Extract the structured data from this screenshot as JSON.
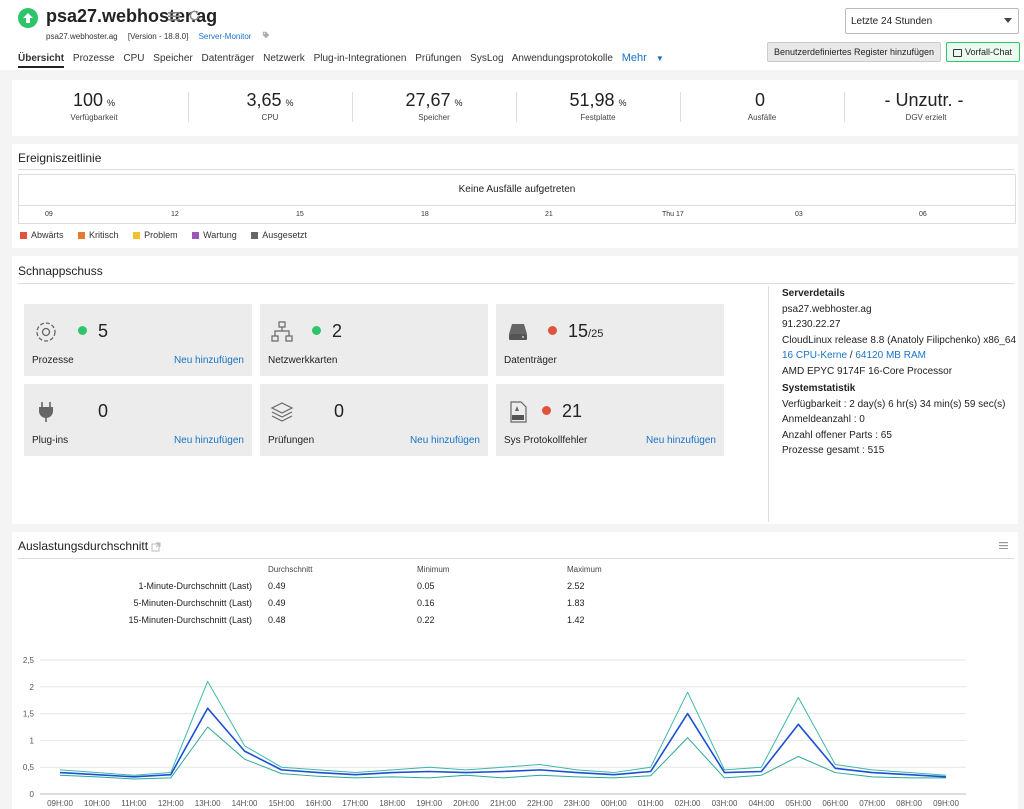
{
  "header": {
    "host": "psa27.webhoster.ag",
    "subhost": "psa27.webhoster.ag",
    "version": "[Version - 18.8.0]",
    "monitor_type": "Server-Monitor",
    "time_range": "Letzte 24 Stunden",
    "register_button": "Benutzerdefiniertes Register hinzufügen",
    "chat_button": "Vorfall-Chat"
  },
  "nav": {
    "tabs": [
      "Übersicht",
      "Prozesse",
      "CPU",
      "Speicher",
      "Datenträger",
      "Netzwerk",
      "Plug-in-Integrationen",
      "Prüfungen",
      "SysLog",
      "Anwendungsprotokolle"
    ],
    "more": "Mehr"
  },
  "kpis": [
    {
      "value": "100",
      "unit": "%",
      "label": "Verfügbarkeit"
    },
    {
      "value": "3,65",
      "unit": "%",
      "label": "CPU"
    },
    {
      "value": "27,67",
      "unit": "%",
      "label": "Speicher"
    },
    {
      "value": "51,98",
      "unit": "%",
      "label": "Festplatte"
    },
    {
      "value": "0",
      "unit": "",
      "label": "Ausfälle"
    },
    {
      "value": "- Unzutr. -",
      "unit": "",
      "label": "DGV erzielt"
    }
  ],
  "timeline": {
    "title": "Ereigniszeitlinie",
    "message": "Keine Ausfälle aufgetreten",
    "ticks": [
      "09",
      "12",
      "15",
      "18",
      "21",
      "Thu 17",
      "03",
      "06"
    ],
    "legend": [
      {
        "label": "Abwärts",
        "color": "#e0523a"
      },
      {
        "label": "Kritisch",
        "color": "#e87a30"
      },
      {
        "label": "Problem",
        "color": "#f2c12e"
      },
      {
        "label": "Wartung",
        "color": "#9b59b6"
      },
      {
        "label": "Ausgesetzt",
        "color": "#666666"
      }
    ]
  },
  "snapshot": {
    "title": "Schnappschuss",
    "add_label": "Neu hinzufügen",
    "cards": [
      {
        "name": "Prozesse",
        "value": "5",
        "sub": "",
        "status": "green"
      },
      {
        "name": "Netzwerkkarten",
        "value": "2",
        "sub": "",
        "status": "green"
      },
      {
        "name": "Datenträger",
        "value": "15",
        "sub": "/25",
        "status": "red"
      },
      {
        "name": "Plug-ins",
        "value": "0",
        "sub": "",
        "status": ""
      },
      {
        "name": "Prüfungen",
        "value": "0",
        "sub": "",
        "status": ""
      },
      {
        "name": "Sys Protokollfehler",
        "value": "21",
        "sub": "",
        "status": "red"
      }
    ],
    "details": {
      "title": "Serverdetails",
      "hostname": "psa27.webhoster.ag",
      "ip": "91.230.22.27",
      "os": "CloudLinux release 8.8 (Anatoly Filipchenko)  x86_64",
      "cpu_cores": "16 CPU-Kerne",
      "sep": " / ",
      "ram": "64120 MB RAM",
      "processor": "AMD EPYC 9174F 16-Core Processor",
      "stats_title": "Systemstatistik",
      "uptime": "Verfügbarkeit : 2 day(s) 6 hr(s) 34 min(s) 59 sec(s)",
      "logins": "Anmeldeanzahl : 0",
      "open_ports": "Anzahl offener Parts : 65",
      "processes": "Prozesse gesamt : 515"
    }
  },
  "load": {
    "title": "Auslastungsdurchschnitt",
    "columns": [
      "Durchschnitt",
      "Minimum",
      "Maximum"
    ],
    "rows": [
      {
        "label": "1-Minute-Durchschnitt (Last)",
        "avg": "0.49",
        "min": "0.05",
        "max": "2.52"
      },
      {
        "label": "5-Minuten-Durchschnitt (Last)",
        "avg": "0.49",
        "min": "0.16",
        "max": "1.83"
      },
      {
        "label": "15-Minuten-Durchschnitt (Last)",
        "avg": "0.48",
        "min": "0.22",
        "max": "1.42"
      }
    ]
  },
  "colors": {
    "accent": "#1a73c8",
    "up": "#2ec46a",
    "series_main": "#1a4fd6",
    "series_light": "#2aa89a"
  },
  "chart_data": {
    "type": "line",
    "x": [
      "09H:00",
      "10H:00",
      "11H:00",
      "12H:00",
      "13H:00",
      "14H:00",
      "15H:00",
      "16H:00",
      "17H:00",
      "18H:00",
      "19H:00",
      "20H:00",
      "21H:00",
      "22H:00",
      "23H:00",
      "00H:00",
      "01H:00",
      "02H:00",
      "03H:00",
      "04H:00",
      "05H:00",
      "06H:00",
      "07H:00",
      "08H:00",
      "09H:00"
    ],
    "ylim": [
      0,
      2.5
    ],
    "yticks": [
      "0",
      "0,5",
      "1",
      "1,5",
      "2",
      "2,5"
    ],
    "series": [
      {
        "values": [
          0.35,
          0.32,
          0.28,
          0.3,
          1.25,
          0.65,
          0.38,
          0.33,
          0.3,
          0.32,
          0.3,
          0.35,
          0.3,
          0.35,
          0.32,
          0.3,
          0.34,
          1.05,
          0.3,
          0.35,
          0.7,
          0.4,
          0.32,
          0.3,
          0.3
        ]
      },
      {
        "values": [
          0.45,
          0.4,
          0.35,
          0.4,
          2.1,
          0.9,
          0.5,
          0.45,
          0.4,
          0.45,
          0.5,
          0.45,
          0.5,
          0.55,
          0.45,
          0.4,
          0.5,
          1.9,
          0.45,
          0.5,
          1.8,
          0.55,
          0.45,
          0.4,
          0.35
        ]
      },
      {
        "values": [
          0.4,
          0.36,
          0.32,
          0.36,
          1.6,
          0.8,
          0.45,
          0.4,
          0.36,
          0.4,
          0.42,
          0.4,
          0.42,
          0.45,
          0.4,
          0.36,
          0.42,
          1.5,
          0.4,
          0.42,
          1.3,
          0.48,
          0.4,
          0.36,
          0.32
        ]
      }
    ]
  }
}
